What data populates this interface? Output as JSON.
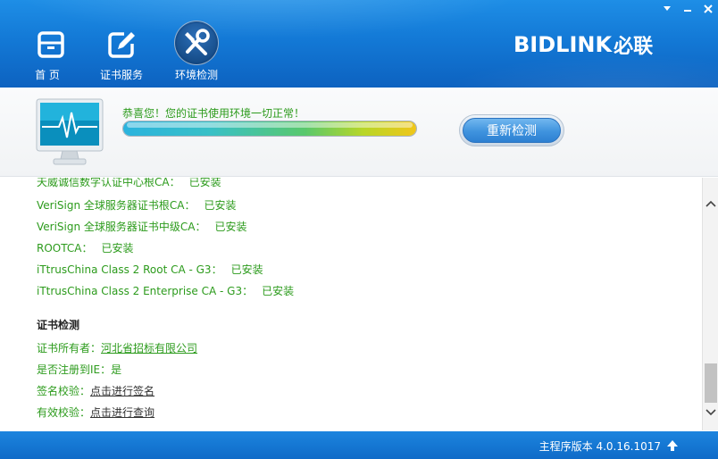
{
  "window": {
    "controls": [
      "menu",
      "minimize",
      "close"
    ]
  },
  "nav": {
    "items": [
      {
        "label": "首 页",
        "icon": "home-drawer-icon",
        "active": false
      },
      {
        "label": "证书服务",
        "icon": "edit-certificate-icon",
        "active": false
      },
      {
        "label": "环境检测",
        "icon": "tools-wrench-icon",
        "active": true
      }
    ]
  },
  "brand": {
    "latin": "BIDLINK",
    "cjk": "必联"
  },
  "status": {
    "message": "恭喜您！您的证书使用环境一切正常！",
    "progress": 1.0,
    "recheck_label": "重新检测"
  },
  "certificates": {
    "partial_row": {
      "name": "天威诚信数字认证中心根CA：",
      "status": "已安装"
    },
    "rows": [
      {
        "name": "VeriSign 全球服务器证书根CA：",
        "status": "已安装"
      },
      {
        "name": "VeriSign 全球服务器证书中级CA：",
        "status": "已安装"
      },
      {
        "name": "ROOTCA：",
        "status": "已安装"
      },
      {
        "name": "iTtrusChina Class 2 Root CA - G3：",
        "status": "已安装"
      },
      {
        "name": "iTtrusChina Class 2 Enterprise CA - G3：",
        "status": "已安装"
      }
    ]
  },
  "cert_check": {
    "title": "证书检测",
    "owner_label": "证书所有者：",
    "owner_value": "河北省招标有限公司",
    "ie_label": "是否注册到IE：",
    "ie_value": "是",
    "sign_label": "签名校验：",
    "sign_link": "点击进行签名",
    "valid_label": "有效校验：",
    "valid_link": "点击进行查询"
  },
  "footer": {
    "version_text": "主程序版本 4.0.16.1017"
  },
  "colors": {
    "header_blue": "#1379d6",
    "status_green": "#2c9b1c",
    "footer_blue": "#0f6bc8"
  }
}
